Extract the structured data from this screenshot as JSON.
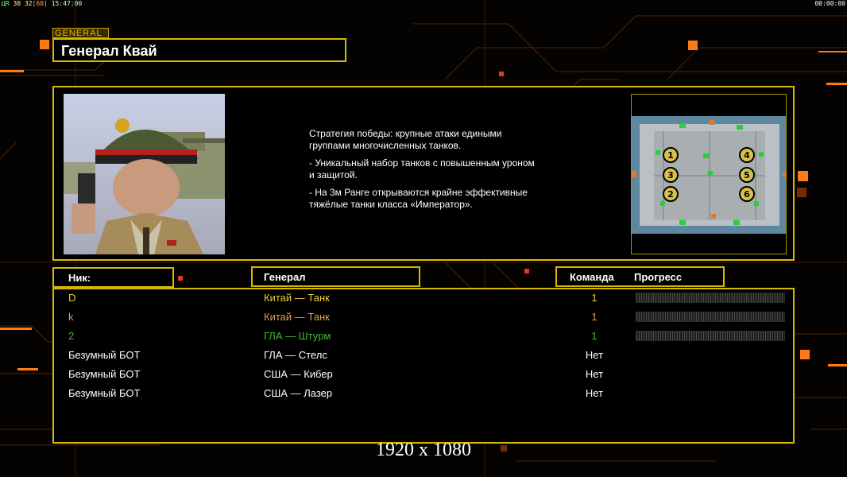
{
  "hud": {
    "left_a": "ЦR",
    "left_b": "30",
    "left_c": "32",
    "left_d": "[60]",
    "left_time": "15:47:00",
    "right_time": "00:00:00"
  },
  "general": {
    "tag": "GENERAL",
    "name": "Генерал Квай",
    "description": [
      "Стратегия победы: крупные атаки едиными\n группами многочисленных танков.",
      "- Уникальный набор танков с повышенным уроном\n и защитой.",
      "- На 3м Ранге открываются крайне эффективные\n тяжёлые танки класса «Император»."
    ]
  },
  "map": {
    "slots": [
      "1",
      "2",
      "3",
      "4",
      "5",
      "6"
    ]
  },
  "headers": {
    "nick": "Ник:",
    "general": "Генерал",
    "team": "Команда",
    "progress": "Прогресс"
  },
  "players": [
    {
      "nick": "D",
      "general": "Китай — Танк",
      "team": "1",
      "color": "#e6cf3c",
      "progress": 0
    },
    {
      "nick": "k",
      "general": "Китай — Танк",
      "team": "1",
      "color": "#d8a05a",
      "progress": 0
    },
    {
      "nick": "2",
      "general": "ГЛА — Штурм",
      "team": "1",
      "color": "#3fbd2f",
      "progress": 0
    },
    {
      "nick": "Безумный БОТ",
      "general": "ГЛА — Стелс",
      "team": "Нет",
      "color": "#ffffff"
    },
    {
      "nick": "Безумный БОТ",
      "general": "США — Кибер",
      "team": "Нет",
      "color": "#ffffff"
    },
    {
      "nick": "Безумный БОТ",
      "general": "США — Лазер",
      "team": "Нет",
      "color": "#ffffff"
    }
  ],
  "resolution": "1920 x 1080",
  "colors": {
    "accent": "#d8b800",
    "orange": "#ff7a12",
    "background": "#050302"
  }
}
